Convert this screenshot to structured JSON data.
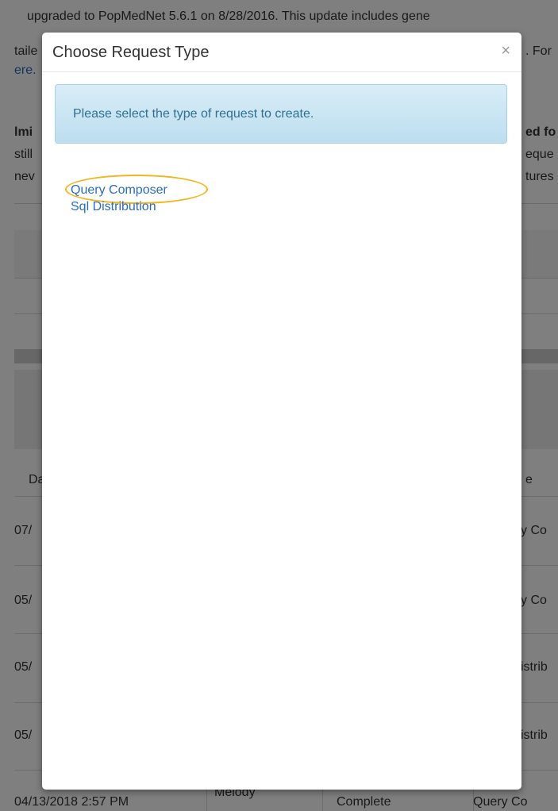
{
  "background": {
    "notice_line1": "upgraded to PopMedNet 5.6.1 on 8/28/2016. This update includes gene",
    "notice_line2_left": "taile",
    "notice_line2_right": ". For",
    "notice_line3_link": "ere.",
    "admin_left": "lmi",
    "admin_right": "ed fo",
    "still_left": "still",
    "still_right": "eque",
    "new_left": "nev",
    "new_right": "tures",
    "col_left_header": "Da",
    "col_right_header": "e",
    "rows": [
      {
        "left": "07/",
        "right": "y Co"
      },
      {
        "left": "05/",
        "right": "y Co"
      },
      {
        "left": "05/",
        "right": "istrib"
      },
      {
        "left": "05/",
        "right": "istrib"
      }
    ],
    "last_row": {
      "date": "04/13/2018 2:57 PM",
      "name": "Melody",
      "status": "Complete",
      "type": "Query Co"
    }
  },
  "modal": {
    "title": "Choose Request Type",
    "close_glyph": "×",
    "alert_text": "Please select the type of request to create.",
    "request_types": [
      "Query Composer",
      "Sql Distribution"
    ],
    "highlight_color": "#f2b51d"
  }
}
